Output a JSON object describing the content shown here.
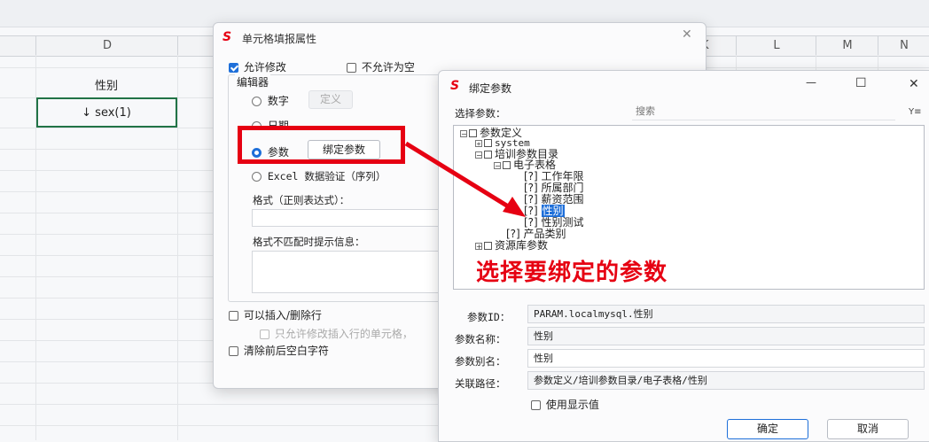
{
  "sheet": {
    "columns": [
      "D",
      "K",
      "L",
      "M",
      "N"
    ],
    "header_cell": "性别",
    "value_cell": "↓ sex(1)"
  },
  "dialog1": {
    "title": "单元格填报属性",
    "close": "✕",
    "allow_edit": "允许修改",
    "not_empty": "不允许为空",
    "editor_label": "编辑器",
    "opt_number": "数字",
    "define_btn": "定义",
    "opt_date": "日期",
    "opt_param": "参数",
    "bind_btn": "绑定参数",
    "opt_excel": "Excel 数据验证（序列）",
    "format_label": "格式（正则表达式）：",
    "mismatch_label": "格式不匹配时提示信息：",
    "insert_delete": "可以插入/删除行",
    "only_inserted": "只允许修改插入行的单元格，",
    "trim": "清除前后空白字符"
  },
  "dialog2": {
    "title": "绑定参数",
    "minimize": "—",
    "maximize": "☐",
    "close": "✕",
    "select_label": "选择参数：",
    "search_placeholder": "搜索",
    "filter_icon": "Y≡",
    "tree": {
      "root": "参数定义",
      "system": "system",
      "training": "培训参数目录",
      "sheet": "电子表格",
      "p1": "[?] 工作年限",
      "p2": "[?] 所属部门",
      "p3": "[?] 薪资范围",
      "p4_prefix": "[?]",
      "p4": "性别",
      "p5": "[?] 性别测试",
      "product": "[?] 产品类别",
      "datasource": "资源库参数"
    },
    "annotation": "选择要绑定的参数",
    "param_id_label": "参数ID：",
    "param_id": "PARAM.localmysql.性别",
    "param_name_label": "参数名称：",
    "param_name": "性别",
    "param_alias_label": "参数别名：",
    "param_alias": "性别",
    "path_label": "关联路径：",
    "path": "参数定义/培训参数目录/电子表格/性别",
    "use_display": "使用显示值",
    "ok": "确定",
    "cancel": "取消"
  },
  "colors": {
    "accent": "#1e6fd9",
    "highlight": "#e60012",
    "brand": "#e60012"
  }
}
